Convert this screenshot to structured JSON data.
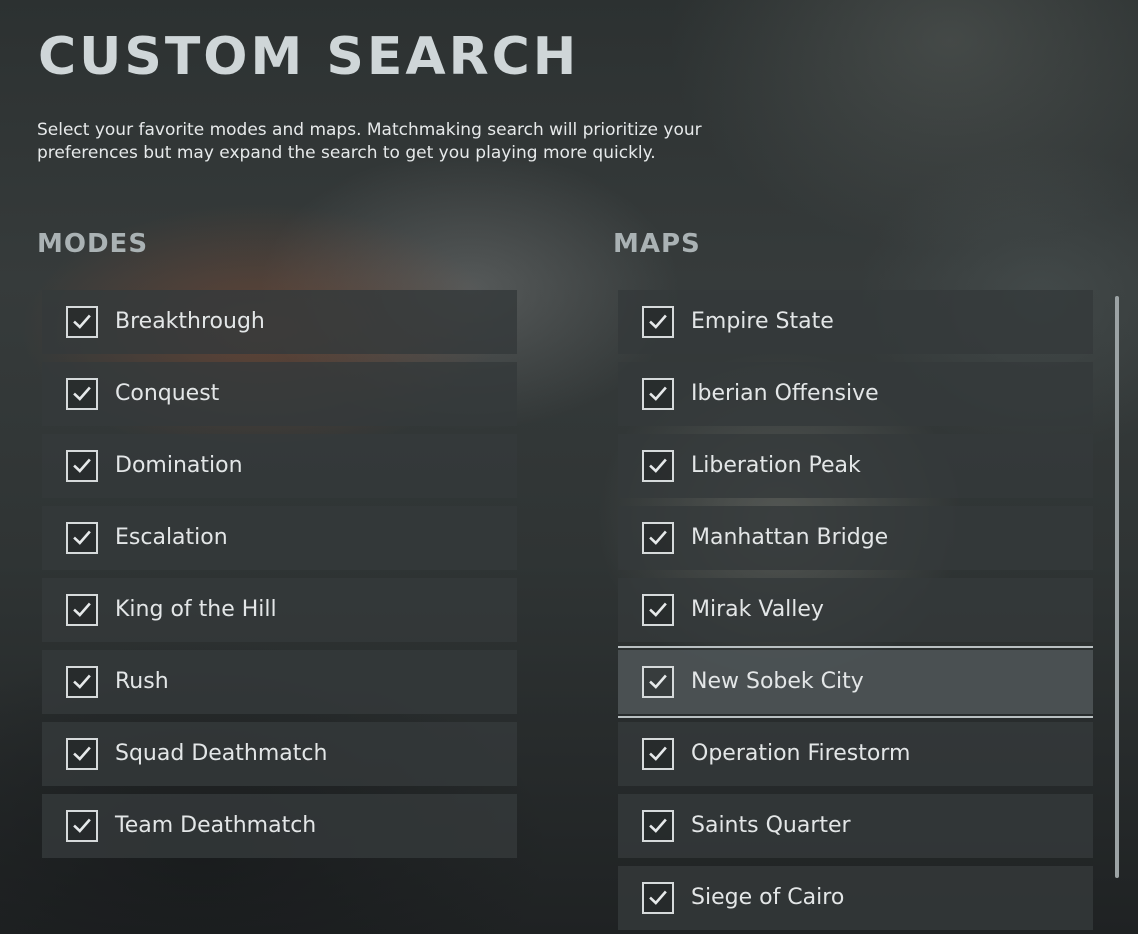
{
  "page": {
    "title": "CUSTOM SEARCH",
    "description": "Select your favorite modes and maps. Matchmaking search will prioritize your preferences but may expand the search to get you playing more quickly."
  },
  "modes": {
    "heading": "MODES",
    "items": [
      {
        "label": "Breakthrough",
        "checked": true
      },
      {
        "label": "Conquest",
        "checked": true
      },
      {
        "label": "Domination",
        "checked": true
      },
      {
        "label": "Escalation",
        "checked": true
      },
      {
        "label": "King of the Hill",
        "checked": true
      },
      {
        "label": "Rush",
        "checked": true
      },
      {
        "label": "Squad Deathmatch",
        "checked": true
      },
      {
        "label": "Team Deathmatch",
        "checked": true
      }
    ]
  },
  "maps": {
    "heading": "MAPS",
    "selected_index": 5,
    "items": [
      {
        "label": "Empire State",
        "checked": true
      },
      {
        "label": "Iberian Offensive",
        "checked": true
      },
      {
        "label": "Liberation Peak",
        "checked": true
      },
      {
        "label": "Manhattan Bridge",
        "checked": true
      },
      {
        "label": "Mirak Valley",
        "checked": true
      },
      {
        "label": "New Sobek City",
        "checked": true
      },
      {
        "label": "Operation Firestorm",
        "checked": true
      },
      {
        "label": "Saints Quarter",
        "checked": true
      },
      {
        "label": "Siege of Cairo",
        "checked": true
      }
    ]
  },
  "icons": {
    "checkbox_mark": "checkmark-icon"
  },
  "colors": {
    "title": "#cfd6d8",
    "row_background": "#34393b",
    "selected_row_background": "#4e5456",
    "selected_outline": "#b9c0c2",
    "checkmark": "#e6e9ea"
  }
}
